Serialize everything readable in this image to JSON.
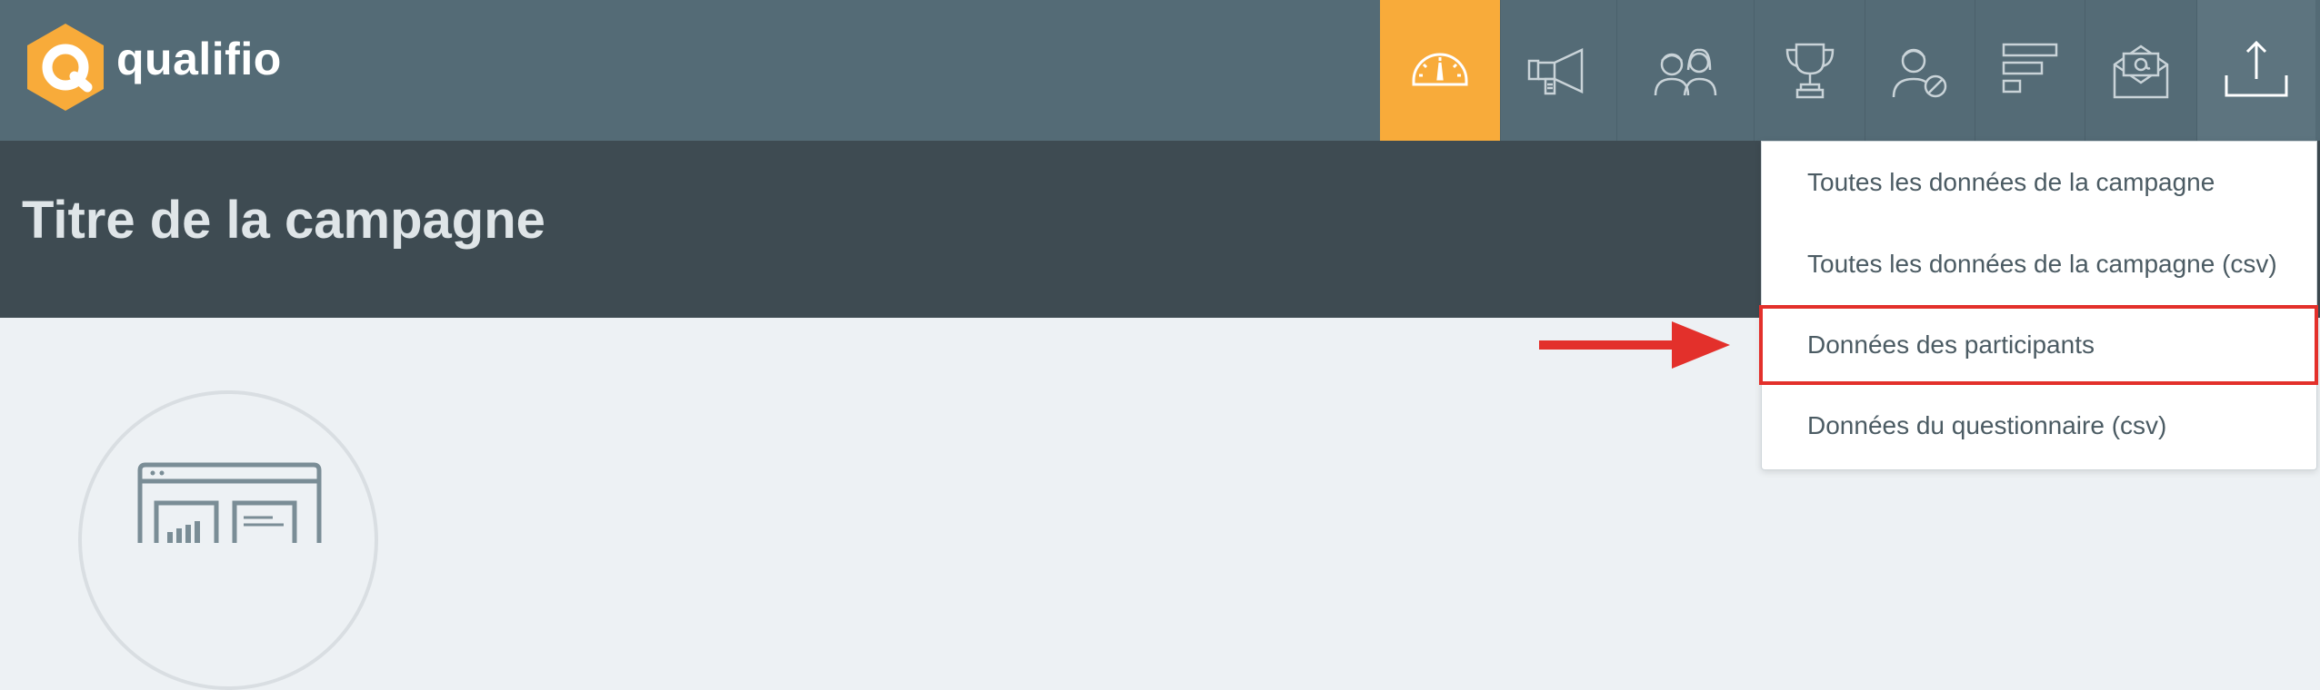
{
  "brand": {
    "name": "qualifio",
    "logo_color": "#f8ab3a"
  },
  "nav": [
    {
      "icon": "dashboard-gauge-icon",
      "active": true
    },
    {
      "icon": "megaphone-icon",
      "active": false
    },
    {
      "icon": "participants-icon",
      "active": false
    },
    {
      "icon": "trophy-icon",
      "active": false
    },
    {
      "icon": "blocked-user-icon",
      "active": false
    },
    {
      "icon": "bar-list-icon",
      "active": false
    },
    {
      "icon": "email-envelope-icon",
      "active": false
    },
    {
      "icon": "export-upload-icon",
      "active": false,
      "open": true
    }
  ],
  "campaign": {
    "title": "Titre de la campagne"
  },
  "export_menu": {
    "items": [
      {
        "label": "Toutes les données de la campagne",
        "highlighted": false
      },
      {
        "label": "Toutes les données de la campagne (csv)",
        "highlighted": false
      },
      {
        "label": "Données des participants",
        "highlighted": true
      },
      {
        "label": "Données du questionnaire (csv)",
        "highlighted": false
      }
    ]
  },
  "colors": {
    "topbar": "#546b76",
    "header": "#3e4b52",
    "accent": "#f8ab3a",
    "highlight_border": "#e3302b",
    "arrow": "#e3302b"
  }
}
